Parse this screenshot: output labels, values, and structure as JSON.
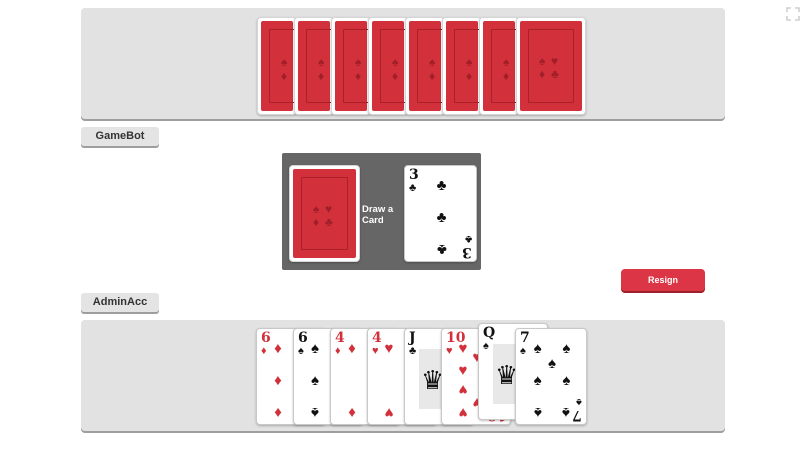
{
  "opponent": {
    "name": "GameBot",
    "card_count": 8
  },
  "player": {
    "name": "AdminAcc",
    "hand": [
      {
        "rank": "6",
        "suit": "♦",
        "color": "red"
      },
      {
        "rank": "6",
        "suit": "♠",
        "color": "black"
      },
      {
        "rank": "4",
        "suit": "♦",
        "color": "red"
      },
      {
        "rank": "4",
        "suit": "♥",
        "color": "red"
      },
      {
        "rank": "J",
        "suit": "♣",
        "color": "black"
      },
      {
        "rank": "10",
        "suit": "♥",
        "color": "red"
      },
      {
        "rank": "Q",
        "suit": "♠",
        "color": "black"
      },
      {
        "rank": "7",
        "suit": "♠",
        "color": "black"
      }
    ]
  },
  "table": {
    "draw_label": "Draw a Card",
    "discard": {
      "rank": "3",
      "suit": "♣",
      "color": "black"
    }
  },
  "actions": {
    "resign_label": "Resign"
  },
  "colors": {
    "card_back": "#d2303a",
    "resign": "#dc3545",
    "panel": "#e2e2e2",
    "center": "#666666"
  }
}
